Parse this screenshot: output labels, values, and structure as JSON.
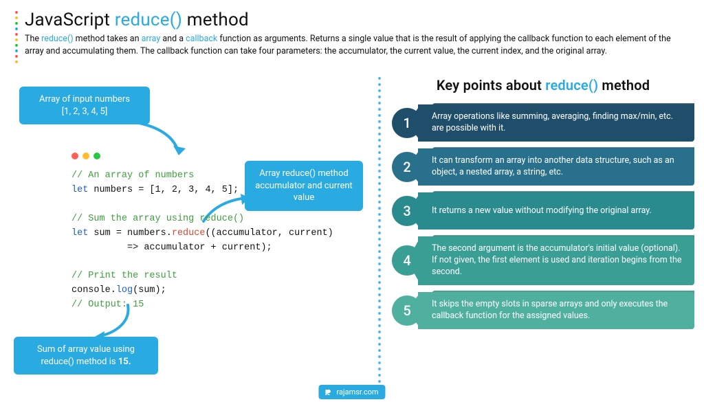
{
  "header": {
    "title_pre": "JavaScript ",
    "title_blue": "reduce()",
    "title_post": " method",
    "sub_a": "The ",
    "sub_b": "reduce()",
    "sub_c": " method takes an ",
    "sub_d": "array",
    "sub_e": " and a ",
    "sub_f": "callback",
    "sub_g": " function as arguments. Returns a single value that is the result of applying the callback function to each element of the array and accumulating them. The callback function can take four parameters: the accumulator, the current value, the current index, and the original array."
  },
  "callouts": {
    "input_l1": "Array of input numbers",
    "input_l2": "[1, 2, 3, 4, 5]",
    "accum_l1": "Array reduce() method",
    "accum_l2": "accumulator and current",
    "accum_l3": "value",
    "sum_l1": "Sum of array value using",
    "sum_l2a": "reduce() method is ",
    "sum_l2b": "15."
  },
  "code": {
    "c1": "// An array of numbers",
    "l1a": "let",
    "l1b": " numbers = [1, 2, 3, 4, 5];",
    "c2": "// Sum the array using reduce()",
    "l2a": "let",
    "l2b": " sum = numbers.",
    "l2c": "reduce",
    "l2d": "((accumulator, current)",
    "l2e": "          => accumulator + current);",
    "c3": "// Print the result",
    "l3a": "console.",
    "l3b": "log",
    "l3c": "(sum);",
    "c4": "// Output: 15"
  },
  "right": {
    "title_a": "Key points about ",
    "title_b": "reduce()",
    "title_c": " method",
    "points": {
      "n1": "1",
      "t1": "Array operations like summing, averaging, finding max/min, etc. are possible with it.",
      "n2": "2",
      "t2": "It can transform an array into another data structure, such as an object, a nested array, a string, etc.",
      "n3": "3",
      "t3": "It returns a new value without modifying the original array.",
      "n4": "4",
      "t4": "The second argument is the accumulator's initial value (optional). If not given, the first element is used and iteration begins from the second.",
      "n5": "5",
      "t5": "It skips the empty slots in sparse arrays and only executes the callback function for the assigned values."
    }
  },
  "footer": {
    "site": "rajamsr.com"
  }
}
